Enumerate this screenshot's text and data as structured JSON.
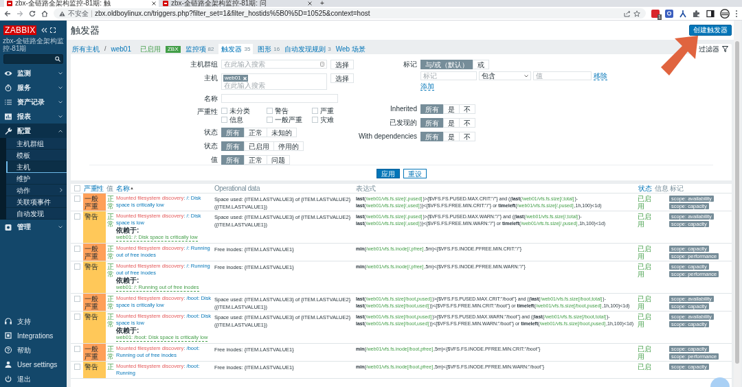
{
  "browser": {
    "tabs": [
      {
        "title": "zbx-全链路全架构监控-81期: 触",
        "selected": true
      },
      {
        "title": "zbx-全链路全架构监控-81期: 问",
        "selected": false
      }
    ],
    "new_tab": "+",
    "security": "不安全",
    "url": "zbx.oldboylinux.cn/triggers.php?filter_set=1&filter_hostids%5B0%5D=10525&context=host",
    "extension_badge": "1"
  },
  "sidebar": {
    "logo": "ZABBIX",
    "subtitle": "zbx-全链路全架构监控-81期",
    "menu": [
      {
        "label": "监测",
        "expanded": false
      },
      {
        "label": "服务",
        "expanded": false
      },
      {
        "label": "资产记录",
        "expanded": false
      },
      {
        "label": "报表",
        "expanded": false
      },
      {
        "label": "配置",
        "expanded": true,
        "children": [
          {
            "label": "主机群组",
            "selected": false,
            "submenu": false
          },
          {
            "label": "模板",
            "selected": false,
            "submenu": false
          },
          {
            "label": "主机",
            "selected": true,
            "submenu": false
          },
          {
            "label": "维护",
            "selected": false,
            "submenu": false
          },
          {
            "label": "动作",
            "selected": false,
            "submenu": true
          },
          {
            "label": "关联项事件",
            "selected": false,
            "submenu": false
          },
          {
            "label": "自动发现",
            "selected": false,
            "submenu": false
          }
        ]
      },
      {
        "label": "管理",
        "expanded": false
      }
    ],
    "bottom": [
      {
        "label": "支持"
      },
      {
        "label": "Integrations"
      },
      {
        "label": "帮助"
      },
      {
        "label": "User settings"
      },
      {
        "label": "退出"
      }
    ]
  },
  "page": {
    "title": "触发器",
    "create_button": "创建触发器"
  },
  "nav": [
    {
      "kind": "link",
      "label": "所有主机"
    },
    {
      "kind": "separator",
      "label": "/"
    },
    {
      "kind": "link",
      "label": "web01"
    },
    {
      "kind": "status",
      "label": "已启用"
    },
    {
      "kind": "badge",
      "label": "ZBX"
    },
    {
      "kind": "tab",
      "label": "监控项",
      "count": "82",
      "selected": false
    },
    {
      "kind": "tab",
      "label": "触发器",
      "count": "35",
      "selected": true
    },
    {
      "kind": "tab",
      "label": "图形",
      "count": "16",
      "selected": false
    },
    {
      "kind": "tab",
      "label": "自动发现规则",
      "count": "3",
      "selected": false
    },
    {
      "kind": "tab",
      "label": "Web 场景",
      "selected": false
    }
  ],
  "filter": {
    "tab": "过滤器",
    "host_groups": {
      "label": "主机群组",
      "placeholder": "在此输入搜索",
      "button": "选择"
    },
    "hosts": {
      "label": "主机",
      "chips": [
        "web01"
      ],
      "placeholder": "在此输入搜索",
      "button": "选择"
    },
    "name": {
      "label": "名称"
    },
    "severity": {
      "label": "严重性",
      "options": [
        {
          "label": "未分类",
          "checked": false
        },
        {
          "label": "警告",
          "checked": false
        },
        {
          "label": "严重",
          "checked": false
        },
        {
          "label": "信息",
          "checked": false
        },
        {
          "label": "一般严重",
          "checked": false
        },
        {
          "label": "灾难",
          "checked": false
        }
      ]
    },
    "toggles_left": [
      {
        "label": "状态",
        "options": [
          {
            "label": "所有",
            "selected": true
          },
          {
            "label": "正常",
            "selected": false
          },
          {
            "label": "未知的",
            "selected": false
          }
        ]
      },
      {
        "label": "状态",
        "options": [
          {
            "label": "所有",
            "selected": true
          },
          {
            "label": "已启用",
            "selected": false
          },
          {
            "label": "停用的",
            "selected": false
          }
        ]
      },
      {
        "label": "值",
        "options": [
          {
            "label": "所有",
            "selected": true
          },
          {
            "label": "正常",
            "selected": false
          },
          {
            "label": "问题",
            "selected": false
          }
        ]
      }
    ],
    "tags": {
      "label": "标记",
      "options": [
        {
          "label": "与/或（默认）",
          "selected": true
        },
        {
          "label": "或",
          "selected": false
        }
      ],
      "tag_placeholder": "标记",
      "operator": "包含",
      "value_placeholder": "值",
      "remove": "移除",
      "add": "添加"
    },
    "toggles_right": [
      {
        "label": "Inherited",
        "options": [
          {
            "label": "所有",
            "selected": true
          },
          {
            "label": "是",
            "selected": false
          },
          {
            "label": "不",
            "selected": false
          }
        ]
      },
      {
        "label": "已发现的",
        "options": [
          {
            "label": "所有",
            "selected": true
          },
          {
            "label": "是",
            "selected": false
          },
          {
            "label": "不",
            "selected": false
          }
        ]
      },
      {
        "label": "With dependencies",
        "options": [
          {
            "label": "所有",
            "selected": true
          },
          {
            "label": "是",
            "selected": false
          },
          {
            "label": "不",
            "selected": false
          }
        ]
      }
    ],
    "apply": "应用",
    "reset": "重设"
  },
  "table": {
    "select_all": {
      "checked": false
    },
    "columns": [
      {
        "label": "严重性",
        "sortable": true
      },
      {
        "label": "值",
        "sortable": false
      },
      {
        "label": "名称",
        "sortable": true,
        "sort": "▲"
      },
      {
        "label": "Operational data",
        "sortable": false
      },
      {
        "label": "表达式",
        "sortable": false
      },
      {
        "label": "状态",
        "sortable": true
      },
      {
        "label": "信息",
        "sortable": false
      },
      {
        "label": "标记",
        "sortable": false
      }
    ],
    "rows": [
      {
        "selected": false,
        "severity": "一般严重",
        "color": "#ffa059",
        "value": "正常",
        "name_prefix": "Mounted filesystem discovery",
        "name": ": /: Disk space is critically low",
        "operational_data": "Space used: {ITEM.LASTVALUE3} of {ITEM.LASTVALUE2} ({ITEM.LASTVALUE1})",
        "expression": [
          {
            "kind": "fn",
            "text": "last"
          },
          {
            "kind": "text",
            "text": "("
          },
          {
            "kind": "item",
            "text": "/web01/vfs.fs.size[/,pused]"
          },
          {
            "kind": "text",
            "text": ")>{$VFS.FS.PUSED.MAX.CRIT:\"/\"} and (("
          },
          {
            "kind": "fn",
            "text": "last"
          },
          {
            "kind": "text",
            "text": "("
          },
          {
            "kind": "item",
            "text": "/web01/vfs.fs.size[/,total]"
          },
          {
            "kind": "text",
            "text": ")-"
          },
          {
            "kind": "fn",
            "text": "last"
          },
          {
            "kind": "text",
            "text": "("
          },
          {
            "kind": "item",
            "text": "/web01/vfs.fs.size[/,used]"
          },
          {
            "kind": "text",
            "text": "))<{$VFS.FS.FREE.MIN.CRIT:\"/\"} or "
          },
          {
            "kind": "fn",
            "text": "timeleft"
          },
          {
            "kind": "text",
            "text": "("
          },
          {
            "kind": "item",
            "text": "/web01/vfs.fs.size[/,pused]"
          },
          {
            "kind": "text",
            "text": ",1h,100)<1d)"
          }
        ],
        "status": "已启用",
        "tags": [
          "scope: availability",
          "scope: capacity"
        ]
      },
      {
        "selected": false,
        "severity": "警告",
        "color": "#ffc859",
        "value": "正常",
        "name_prefix": "Mounted filesystem discovery",
        "name": ": /: Disk space is low",
        "depends_label": "依赖于:",
        "depends": "web01: /: Disk space is critically low",
        "operational_data": "Space used: {ITEM.LASTVALUE3} of {ITEM.LASTVALUE2} ({ITEM.LASTVALUE1})",
        "expression": [
          {
            "kind": "fn",
            "text": "last"
          },
          {
            "kind": "text",
            "text": "("
          },
          {
            "kind": "item",
            "text": "/web01/vfs.fs.size[/,pused]"
          },
          {
            "kind": "text",
            "text": ")>{$VFS.FS.PUSED.MAX.WARN:\"/\"} and (("
          },
          {
            "kind": "fn",
            "text": "last"
          },
          {
            "kind": "text",
            "text": "("
          },
          {
            "kind": "item",
            "text": "/web01/vfs.fs.size[/,total]"
          },
          {
            "kind": "text",
            "text": ")-"
          },
          {
            "kind": "fn",
            "text": "last"
          },
          {
            "kind": "text",
            "text": "("
          },
          {
            "kind": "item",
            "text": "/web01/vfs.fs.size[/,used]"
          },
          {
            "kind": "text",
            "text": "))<{$VFS.FS.FREE.MIN.WARN:\"/\"} or "
          },
          {
            "kind": "fn",
            "text": "timeleft"
          },
          {
            "kind": "text",
            "text": "("
          },
          {
            "kind": "item",
            "text": "/web01/vfs.fs.size[/,pused]"
          },
          {
            "kind": "text",
            "text": ",1h,100)<1d)"
          }
        ],
        "status": "已启用",
        "tags": [
          "scope: availability",
          "scope: capacity"
        ]
      },
      {
        "selected": false,
        "severity": "一般严重",
        "color": "#ffa059",
        "value": "正常",
        "name_prefix": "Mounted filesystem discovery",
        "name": ": /: Running out of free inodes",
        "operational_data": "Free inodes: {ITEM.LASTVALUE1}",
        "expression": [
          {
            "kind": "fn",
            "text": "min"
          },
          {
            "kind": "text",
            "text": "("
          },
          {
            "kind": "item",
            "text": "/web01/vfs.fs.inode[/,pfree]"
          },
          {
            "kind": "text",
            "text": ",5m)<{$VFS.FS.INODE.PFREE.MIN.CRIT:\"/\"}"
          }
        ],
        "status": "已启用",
        "tags": [
          "scope: capacity",
          "scope: performance"
        ]
      },
      {
        "selected": false,
        "severity": "警告",
        "color": "#ffc859",
        "value": "正常",
        "name_prefix": "Mounted filesystem discovery",
        "name": ": /: Running out of free inodes",
        "depends_label": "依赖于:",
        "depends": "web01: /: Running out of free inodes",
        "operational_data": "Free inodes: {ITEM.LASTVALUE1}",
        "expression": [
          {
            "kind": "fn",
            "text": "min"
          },
          {
            "kind": "text",
            "text": "("
          },
          {
            "kind": "item",
            "text": "/web01/vfs.fs.inode[/,pfree]"
          },
          {
            "kind": "text",
            "text": ",5m)<{$VFS.FS.INODE.PFREE.MIN.WARN:\"/\"}"
          }
        ],
        "status": "已启用",
        "tags": [
          "scope: capacity",
          "scope: performance"
        ]
      },
      {
        "selected": false,
        "severity": "一般严重",
        "color": "#ffa059",
        "value": "正常",
        "name_prefix": "Mounted filesystem discovery",
        "name": ": /boot: Disk space is critically low",
        "operational_data": "Space used: {ITEM.LASTVALUE3} of {ITEM.LASTVALUE2} ({ITEM.LASTVALUE1})",
        "expression": [
          {
            "kind": "fn",
            "text": "last"
          },
          {
            "kind": "text",
            "text": "("
          },
          {
            "kind": "item",
            "text": "/web01/vfs.fs.size[/boot,pused]"
          },
          {
            "kind": "text",
            "text": ")>{$VFS.FS.PUSED.MAX.CRIT:\"/boot\"} and (("
          },
          {
            "kind": "fn",
            "text": "last"
          },
          {
            "kind": "text",
            "text": "("
          },
          {
            "kind": "item",
            "text": "/web01/vfs.fs.size[/boot,total]"
          },
          {
            "kind": "text",
            "text": ")-"
          },
          {
            "kind": "fn",
            "text": "last"
          },
          {
            "kind": "text",
            "text": "("
          },
          {
            "kind": "item",
            "text": "/web01/vfs.fs.size[/boot,used]"
          },
          {
            "kind": "text",
            "text": "))<{$VFS.FS.FREE.MIN.CRIT:\"/boot\"} or "
          },
          {
            "kind": "fn",
            "text": "timeleft"
          },
          {
            "kind": "text",
            "text": "("
          },
          {
            "kind": "item",
            "text": "/web01/vfs.fs.size[/boot,pused]"
          },
          {
            "kind": "text",
            "text": ",1h,100)<1d)"
          }
        ],
        "status": "已启用",
        "tags": [
          "scope: availability",
          "scope: capacity"
        ]
      },
      {
        "selected": false,
        "severity": "警告",
        "color": "#ffc859",
        "value": "正常",
        "name_prefix": "Mounted filesystem discovery",
        "name": ": /boot: Disk space is low",
        "depends_label": "依赖于:",
        "depends": "web01: /boot: Disk space is critically low",
        "operational_data": "Space used: {ITEM.LASTVALUE3} of {ITEM.LASTVALUE2} ({ITEM.LASTVALUE1})",
        "expression": [
          {
            "kind": "fn",
            "text": "last"
          },
          {
            "kind": "text",
            "text": "("
          },
          {
            "kind": "item",
            "text": "/web01/vfs.fs.size[/boot,pused]"
          },
          {
            "kind": "text",
            "text": ")>{$VFS.FS.PUSED.MAX.WARN:\"/boot\"} and (("
          },
          {
            "kind": "fn",
            "text": "last"
          },
          {
            "kind": "text",
            "text": "("
          },
          {
            "kind": "item",
            "text": "/web01/vfs.fs.size[/boot,total]"
          },
          {
            "kind": "text",
            "text": ")-"
          },
          {
            "kind": "fn",
            "text": "last"
          },
          {
            "kind": "text",
            "text": "("
          },
          {
            "kind": "item",
            "text": "/web01/vfs.fs.size[/boot,used]"
          },
          {
            "kind": "text",
            "text": "))<{$VFS.FS.FREE.MIN.WARN:\"/boot\"} or "
          },
          {
            "kind": "fn",
            "text": "timeleft"
          },
          {
            "kind": "text",
            "text": "("
          },
          {
            "kind": "item",
            "text": "/web01/vfs.fs.size[/boot,pused]"
          },
          {
            "kind": "text",
            "text": ",1h,100)<1d)"
          }
        ],
        "status": "已启用",
        "tags": [
          "scope: availability",
          "scope: capacity"
        ]
      },
      {
        "selected": false,
        "severity": "一般严重",
        "color": "#ffa059",
        "value": "正常",
        "name_prefix": "Mounted filesystem discovery",
        "name": ": /boot: Running out of free inodes",
        "operational_data": "Free inodes: {ITEM.LASTVALUE1}",
        "expression": [
          {
            "kind": "fn",
            "text": "min"
          },
          {
            "kind": "text",
            "text": "("
          },
          {
            "kind": "item",
            "text": "/web01/vfs.fs.inode[/boot,pfree]"
          },
          {
            "kind": "text",
            "text": ",5m)<{$VFS.FS.INODE.PFREE.MIN.CRIT:\"/boot\"}"
          }
        ],
        "status": "已启用",
        "tags": [
          "scope: capacity",
          "scope: performance"
        ]
      },
      {
        "selected": false,
        "severity": "警告",
        "color": "#ffc859",
        "value": "正",
        "name_prefix": "Mounted filesystem discovery",
        "name": ": /boot: Running",
        "operational_data": "Free inodes: {ITEM.LASTVALUE1}",
        "expression": [
          {
            "kind": "fn",
            "text": "min"
          },
          {
            "kind": "text",
            "text": "("
          },
          {
            "kind": "item",
            "text": "/web01/vfs.fs.inode[/boot,pfree]"
          },
          {
            "kind": "text",
            "text": ",5m)<{$VFS.FS.INODE.PFREE.MIN.WARN:\"/boot\"}"
          }
        ],
        "status": "已启",
        "tags": [
          "scope: capacity"
        ]
      }
    ]
  }
}
